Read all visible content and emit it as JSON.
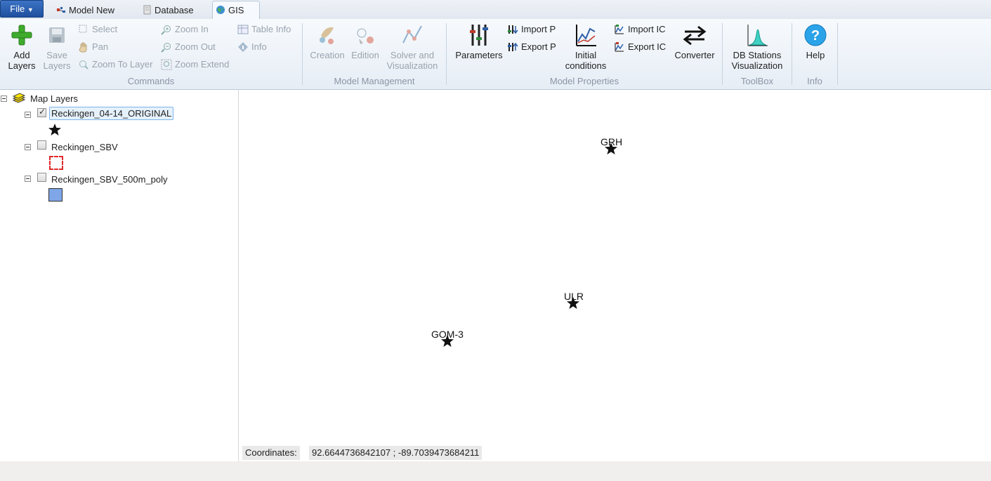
{
  "tabs": {
    "file": "File",
    "items": [
      {
        "label": "Model New",
        "icon": "model-icon"
      },
      {
        "label": "Database",
        "icon": "database-icon"
      },
      {
        "label": "GIS",
        "icon": "globe-icon"
      }
    ],
    "active": "GIS"
  },
  "ribbon": {
    "commands": {
      "group_label": "Commands",
      "add_layers": "Add Layers",
      "save_layers": "Save Layers",
      "select": "Select",
      "pan": "Pan",
      "zoom_to_layer": "Zoom To Layer",
      "zoom_in": "Zoom In",
      "zoom_out": "Zoom Out",
      "zoom_extend": "Zoom Extend",
      "table_info": "Table Info",
      "info": "Info"
    },
    "model_management": {
      "group_label": "Model Management",
      "creation": "Creation",
      "edition": "Edition",
      "solver": "Solver and Visualization"
    },
    "model_properties": {
      "group_label": "Model Properties",
      "parameters": "Parameters",
      "import_p": "Import P",
      "export_p": "Export P",
      "initial_conditions": "Initial conditions",
      "import_ic": "Import IC",
      "export_ic": "Export IC",
      "converter": "Converter"
    },
    "toolbox": {
      "group_label": "ToolBox",
      "db_stations": "DB Stations Visualization"
    },
    "info": {
      "group_label": "Info",
      "help": "Help"
    }
  },
  "tree": {
    "root": "Map Layers",
    "layers": [
      {
        "name": "Reckingen_04-14_ORIGINAL",
        "checked": true,
        "symbol": "star"
      },
      {
        "name": "Reckingen_SBV",
        "checked": false,
        "symbol": "dashed-red-square"
      },
      {
        "name": "Reckingen_SBV_500m_poly",
        "checked": false,
        "symbol": "blue-square"
      }
    ]
  },
  "map": {
    "stations": [
      {
        "label": "GRH"
      },
      {
        "label": "ULR"
      },
      {
        "label": "GOM-3"
      }
    ]
  },
  "status": {
    "coordinates_label": "Coordinates:",
    "coordinates_value": "92.6644736842107 ; -89.7039473684211"
  }
}
